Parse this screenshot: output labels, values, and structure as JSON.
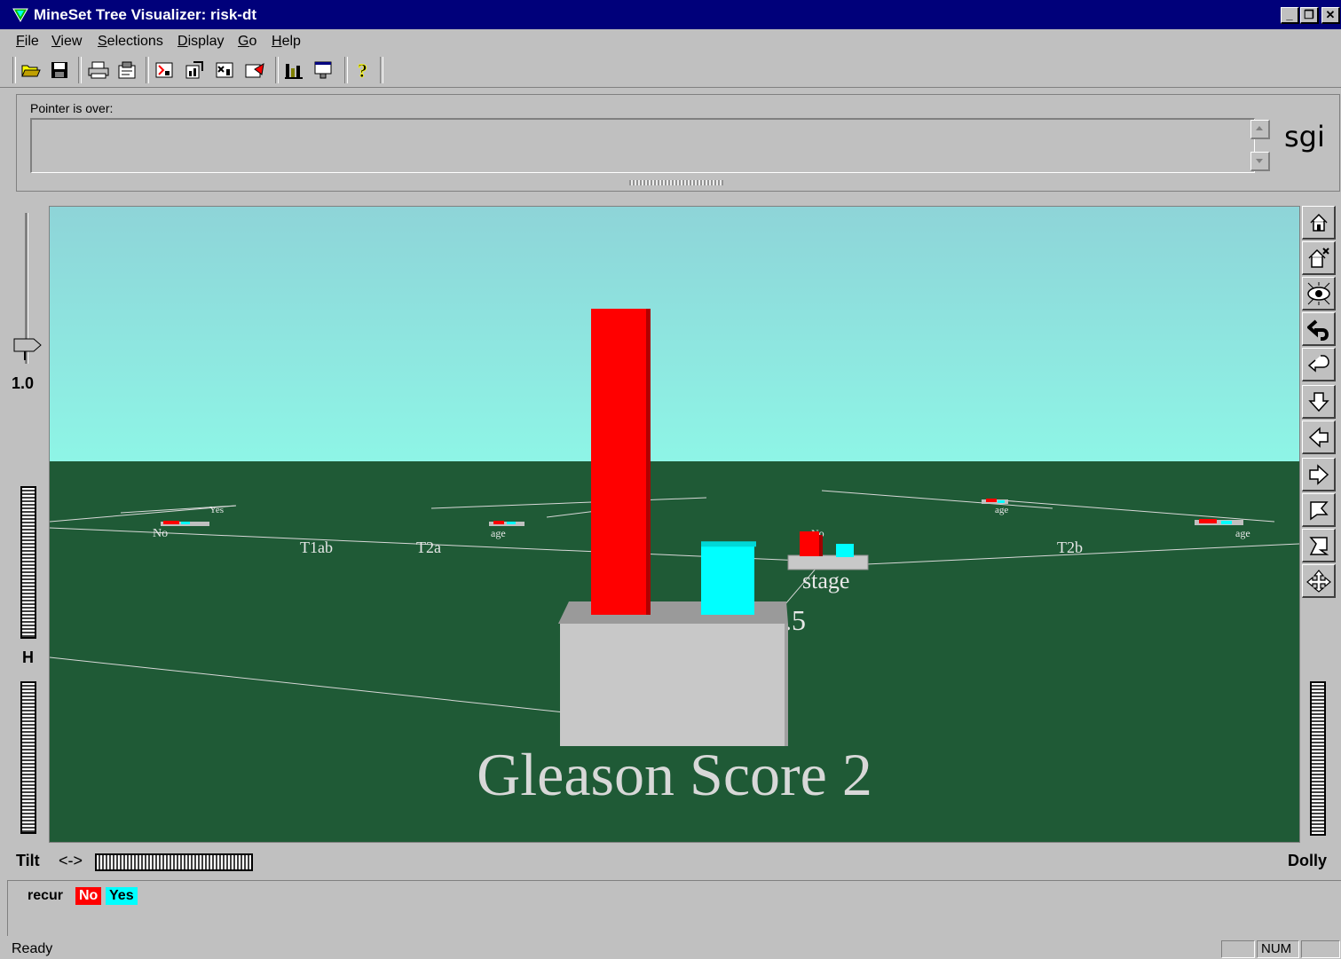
{
  "window": {
    "title": "MineSet Tree Visualizer: risk-dt"
  },
  "menu": {
    "items": [
      {
        "label": "File",
        "key": "F",
        "rest": "ile"
      },
      {
        "label": "View",
        "key": "V",
        "rest": "iew"
      },
      {
        "label": "Selections",
        "key": "S",
        "rest": "elections"
      },
      {
        "label": "Display",
        "key": "D",
        "rest": "isplay"
      },
      {
        "label": "Go",
        "key": "G",
        "rest": "o"
      },
      {
        "label": "Help",
        "key": "H",
        "rest": "elp"
      }
    ]
  },
  "toolbar": {
    "icons": [
      "open-icon",
      "save-icon",
      "print-icon",
      "properties-icon",
      "tool-a-icon",
      "tool-b-icon",
      "tool-c-icon",
      "tool-d-icon",
      "chart-icon",
      "window-icon",
      "help-icon"
    ]
  },
  "pointer": {
    "label": "Pointer is over:",
    "value": ""
  },
  "brand": {
    "logo": "sgi"
  },
  "controls": {
    "zoom_value": "1.0",
    "height_label": "H",
    "tilt_label": "Tilt",
    "tilt_arrows": "<->",
    "dolly_label": "Dolly"
  },
  "scene": {
    "sky_color": "#8ef0e8",
    "ground_color": "#1f5a36",
    "title_text": "Gleason Score 2",
    "node_label": "stage",
    "partial_label": ".5",
    "branch_labels": [
      "T1ab",
      "T2a",
      "T2b"
    ],
    "small_labels": [
      "No",
      "Yes",
      "No",
      "age",
      "age",
      "age"
    ],
    "bars": [
      {
        "class": "No",
        "color": "#ff0000",
        "height": 0.92
      },
      {
        "class": "Yes",
        "color": "#00ffff",
        "height": 0.21
      }
    ]
  },
  "legend": {
    "attribute": "recur",
    "classes": [
      {
        "label": "No",
        "color": "#ff0000",
        "text_color": "#ffffff"
      },
      {
        "label": "Yes",
        "color": "#00ffff",
        "text_color": "#000000"
      }
    ]
  },
  "status": {
    "text": "Ready",
    "num": "NUM"
  }
}
